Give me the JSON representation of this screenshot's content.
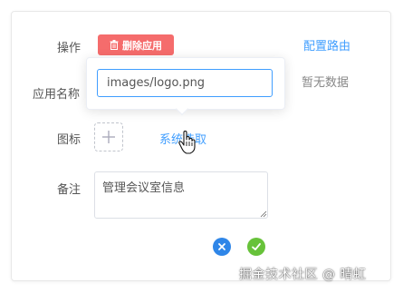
{
  "form": {
    "operation_label": "操作",
    "delete_button": "删除应用",
    "config_route_link": "配置路由",
    "app_name_label": "应用名称",
    "no_data_text": "暂无数据",
    "icon_label": "图标",
    "system_pick_link": "系统选取",
    "remark_label": "备注",
    "remark_value": "管理会议室信息"
  },
  "popover": {
    "input_value": "images/logo.png"
  },
  "colors": {
    "danger": "#f56c6c",
    "primary": "#409eff",
    "success": "#67c23a"
  },
  "watermark": "掘金技术社区 @ 晴虹"
}
